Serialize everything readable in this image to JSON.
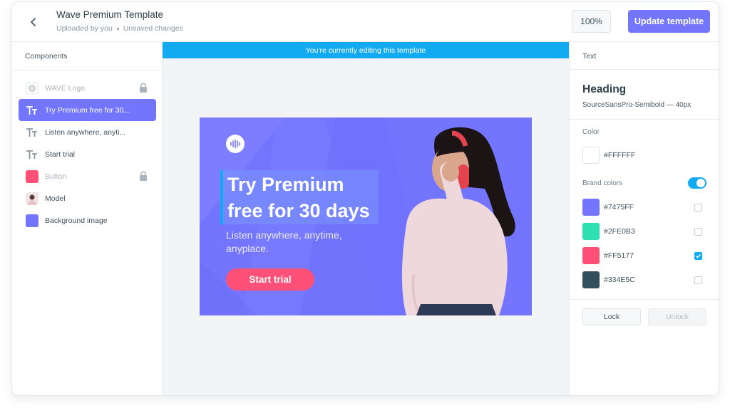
{
  "header": {
    "title": "Wave Premium Template",
    "uploaded": "Uploaded by you",
    "status": "Unsaved changes",
    "zoom": "100%",
    "update_label": "Update template"
  },
  "components": {
    "title": "Components",
    "items": [
      {
        "label": "WAVE Logo",
        "icon": "wave-logo-icon",
        "locked": true,
        "state": "dim"
      },
      {
        "label": "Try Premium free for 30...",
        "icon": "text-icon",
        "locked": false,
        "state": "active"
      },
      {
        "label": "Listen anywhere, anyti...",
        "icon": "text-icon",
        "locked": false,
        "state": "normal"
      },
      {
        "label": "Start trial",
        "icon": "text-icon",
        "locked": false,
        "state": "normal"
      },
      {
        "label": "Button",
        "icon": "button-swatch-icon",
        "locked": true,
        "state": "dim"
      },
      {
        "label": "Model",
        "icon": "model-thumbnail-icon",
        "locked": false,
        "state": "normal"
      },
      {
        "label": "Background image",
        "icon": "background-swatch-icon",
        "locked": false,
        "state": "normal"
      }
    ]
  },
  "canvas": {
    "editing_notice": "You're currently editing this template",
    "ad": {
      "headline": "Try Premium free for 30 days",
      "subtext": "Listen anywhere, anytime, anyplace.",
      "cta": "Start trial"
    }
  },
  "text_panel": {
    "title": "Text",
    "heading": "Heading",
    "font": "SourceSansPro-Semibold — 40px",
    "color_label": "Color",
    "color_value": "#FFFFFF",
    "brand_colors_label": "Brand colors",
    "brand_colors_enabled": true,
    "brand_colors": [
      {
        "hex": "#7475FF",
        "checked": false
      },
      {
        "hex": "#2FE0B3",
        "checked": false
      },
      {
        "hex": "#FF5177",
        "checked": true
      },
      {
        "hex": "#334E5C",
        "checked": false
      }
    ],
    "lock_label": "Lock",
    "unlock_label": "Unlock"
  },
  "colors": {
    "accent": "#7475FF",
    "info_bar": "#12AAF0",
    "cta": "#FF5177"
  }
}
